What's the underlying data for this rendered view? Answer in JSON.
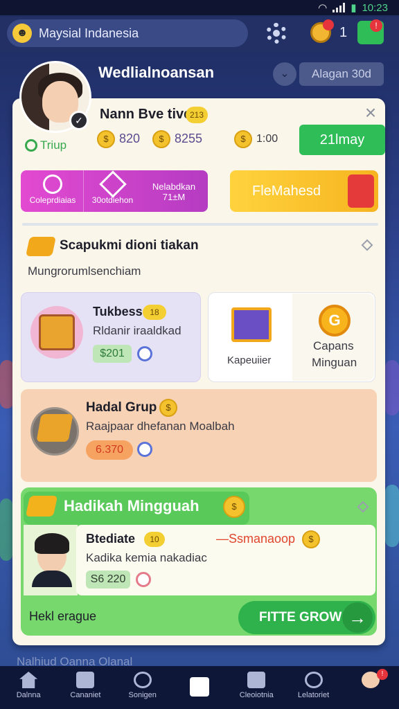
{
  "status_bar": {
    "time": "10:23"
  },
  "top_bar": {
    "search_title": "Maysial Indanesia",
    "notification_count": "1"
  },
  "header": {
    "username": "Wedlialnoansan",
    "chip": "Alagan 30d"
  },
  "profile": {
    "name": "Nann Bve tive",
    "level": "213",
    "stat1": "820",
    "stat2": "8255",
    "stat3": "1:00",
    "status": "Triup",
    "green_pill": "21lmay"
  },
  "actions": {
    "pink_left": "Coleprdiaias",
    "pink_mid": "30otdiehon",
    "pink_right_line1": "Nelabdkan",
    "pink_right_line2": "71±M",
    "yellow_label": "FleMahesd"
  },
  "section": {
    "title": "Scapukmi dioni tiakan",
    "subtitle": "Mungrorumlsenchiam"
  },
  "card_a": {
    "title": "Tukbess",
    "badge": "18",
    "sub": "Rldanir iraaldkad",
    "value": "$201"
  },
  "card_b": {
    "left_label": "Kapeuiier",
    "right_line1": "Capans",
    "right_line2": "Minguan",
    "coin_letter": "G"
  },
  "card_c": {
    "title": "Hadal Grup",
    "sub": "Raajpaar dhefanan Moalbah",
    "value": "6.370"
  },
  "card_d": {
    "title": "Hadikah Mingguah",
    "item_title": "Btediate",
    "item_badge": "10",
    "red_text": "—Ssmanaoop",
    "item_sub": "Kadika kemia nakadiac",
    "value": "S6 220",
    "footer_label": "Hekl erague",
    "cta": "FITTE GROW"
  },
  "ghost_text": "Nalhiud Oanna Olanal",
  "bottom_nav": [
    {
      "label": "Dalnna"
    },
    {
      "label": "Cananiet",
      "badge": ""
    },
    {
      "label": "Sonigen"
    },
    {
      "label": ""
    },
    {
      "label": "Cleoiotnia"
    },
    {
      "label": "Lelatoriet"
    },
    {
      "label": ""
    }
  ],
  "colors": {
    "accent_green": "#2ebd57",
    "accent_pink": "#e24ad1",
    "accent_yellow": "#ffd33d",
    "card_bg": "#fbf6ea"
  }
}
